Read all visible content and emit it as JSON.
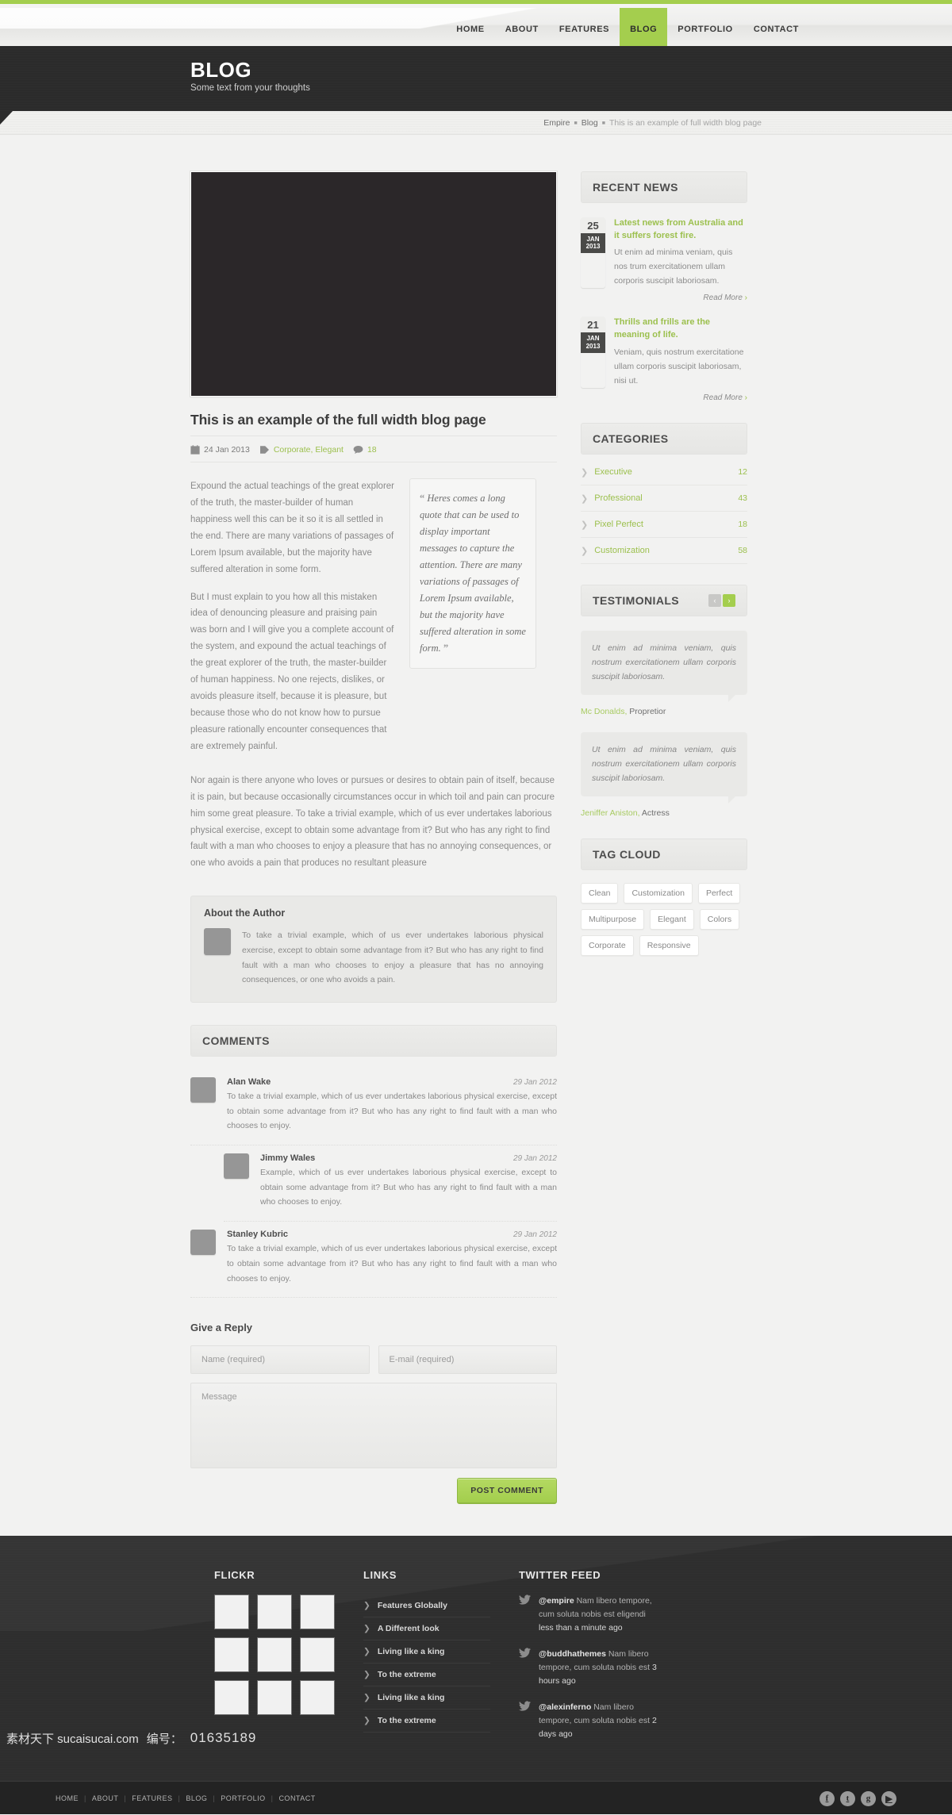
{
  "colors": {
    "accent": "#a4ce4e",
    "dark": "#2b2b2b",
    "body_bg": "#f2f2f1"
  },
  "nav": {
    "items": [
      {
        "label": "HOME",
        "active": false
      },
      {
        "label": "ABOUT",
        "active": false
      },
      {
        "label": "FEATURES",
        "active": false
      },
      {
        "label": "BLOG",
        "active": true
      },
      {
        "label": "PORTFOLIO",
        "active": false
      },
      {
        "label": "CONTACT",
        "active": false
      }
    ]
  },
  "page_header": {
    "title": "BLOG",
    "subtitle": "Some text from your thoughts"
  },
  "breadcrumb": {
    "root": "Empire",
    "section": "Blog",
    "current": "This is an example of full width blog page"
  },
  "post": {
    "title": "This is an example of the full width blog page",
    "date": "24 Jan 2013",
    "tags": "Corporate, Elegant",
    "comment_count": "18",
    "para1": "Expound the actual teachings of the great explorer of the truth, the master-builder of human happiness well this can be it so it is all settled in the end. There are many variations of passages of Lorem Ipsum available, but the majority have suffered alteration in some form.",
    "para2": "But I must explain to you how all this mistaken idea of denouncing pleasure and praising pain was born and I will give you a complete account of the system, and expound the actual teachings of the great explorer of the truth, the master-builder of human happiness. No one rejects, dislikes, or avoids pleasure itself, because it is pleasure, but because those who do not know how to pursue pleasure rationally encounter consequences that are extremely painful.",
    "pullquote": "Heres comes a long quote that can be used to display important messages to capture the attention. There are many variations of passages of Lorem Ipsum available, but the majority have suffered alteration in some form.",
    "para3": "Nor again is there anyone who loves or pursues or desires to obtain pain of itself, because it is pain, but because occasionally circumstances occur in which toil and pain can procure him some great pleasure. To take a trivial example, which of us ever undertakes laborious physical exercise, except to obtain some advantage from it? But who has any right to find fault with a man who chooses to enjoy a pleasure that has no annoying consequences, or one who avoids a pain that produces no resultant pleasure"
  },
  "author_box": {
    "heading": "About the Author",
    "text": "To take a trivial example, which of us ever undertakes laborious physical exercise, except to obtain some advantage from it? But who has any right to find fault with a man who chooses to enjoy a pleasure that has no annoying consequences, or one who avoids a pain."
  },
  "comments": {
    "heading": "COMMENTS",
    "items": [
      {
        "name": "Alan Wake",
        "date": "29 Jan 2012",
        "nested": false,
        "text": "To take a trivial example, which of us ever undertakes laborious physical exercise, except to obtain some advantage from it? But who has any right to find fault with a man who chooses to enjoy."
      },
      {
        "name": "Jimmy Wales",
        "date": "29 Jan 2012",
        "nested": true,
        "text": "Example, which of us ever undertakes laborious physical exercise, except to obtain some advantage from it? But who has any right to find fault with a man who chooses to enjoy."
      },
      {
        "name": "Stanley Kubric",
        "date": "29 Jan 2012",
        "nested": false,
        "text": "To take a trivial example, which of us ever undertakes laborious physical exercise, except to obtain some advantage from it? But who has any right to find fault with a man who chooses to enjoy."
      }
    ]
  },
  "reply": {
    "heading": "Give a Reply",
    "name_placeholder": "Name (required)",
    "email_placeholder": "E-mail (required)",
    "message_placeholder": "Message",
    "name_value": "",
    "email_value": "",
    "message_value": "",
    "submit_label": "POST COMMENT"
  },
  "sidebar": {
    "recent_news": {
      "heading": "RECENT NEWS",
      "items": [
        {
          "day": "25",
          "month": "JAN",
          "year": "2013",
          "title": "Latest news from Australia and it suffers forest fire.",
          "excerpt": "Ut enim ad minima veniam, quis nos trum exercitationem ullam corporis suscipit laboriosam.",
          "read_more": "Read More"
        },
        {
          "day": "21",
          "month": "JAN",
          "year": "2013",
          "title": "Thrills and frills are the meaning of life.",
          "excerpt": "Veniam, quis nostrum exercitatione  ullam corporis suscipit laboriosam, nisi ut.",
          "read_more": "Read More"
        }
      ]
    },
    "categories": {
      "heading": "CATEGORIES",
      "items": [
        {
          "label": "Executive",
          "count": "12"
        },
        {
          "label": "Professional",
          "count": "43"
        },
        {
          "label": "Pixel Perfect",
          "count": "18"
        },
        {
          "label": "Customization",
          "count": "58"
        }
      ]
    },
    "testimonials": {
      "heading": "TESTIMONIALS",
      "prev": "‹",
      "next": "›",
      "items": [
        {
          "quote": "Ut enim ad minima veniam, quis nostrum exercitationem ullam corporis suscipit laboriosam.",
          "author": "Mc Donalds,",
          "role": "Propretior"
        },
        {
          "quote": "Ut enim ad minima veniam, quis nostrum exercitationem ullam corporis suscipit laboriosam.",
          "author": "Jeniffer Aniston,",
          "role": "Actress"
        }
      ]
    },
    "tag_cloud": {
      "heading": "TAG CLOUD",
      "tags": [
        "Clean",
        "Customization",
        "Perfect",
        "Multipurpose",
        "Elegant",
        "Colors",
        "Corporate",
        "Responsive"
      ]
    }
  },
  "footer": {
    "flickr": {
      "heading": "FLICKR",
      "thumb_count": 9
    },
    "links": {
      "heading": "LINKS",
      "items": [
        "Features Globally",
        "A Different look",
        "Living like a king",
        "To the extreme",
        "Living like a king",
        "To the extreme"
      ]
    },
    "twitter": {
      "heading": "TWITTER FEED",
      "items": [
        {
          "handle": "@empire",
          "text": " Nam libero tempore, cum soluta nobis est eligendi ",
          "ago": "less than a minute ago"
        },
        {
          "handle": "@buddhathemes",
          "text": " Nam libero tempore, cum soluta nobis est ",
          "ago": "3 hours ago"
        },
        {
          "handle": "@alexinferno",
          "text": " Nam libero tempore, cum soluta nobis est ",
          "ago": "2 days ago"
        }
      ]
    },
    "bottom": {
      "nav": [
        "HOME",
        "ABOUT",
        "FEATURES",
        "BLOG",
        "PORTFOLIO",
        "CONTACT"
      ],
      "socials": [
        "facebook-icon",
        "twitter-icon",
        "google-plus-icon",
        "youtube-icon"
      ]
    }
  },
  "watermark": {
    "site": "素材天下 sucaisucai.com",
    "label": "编号：",
    "number": "01635189"
  }
}
